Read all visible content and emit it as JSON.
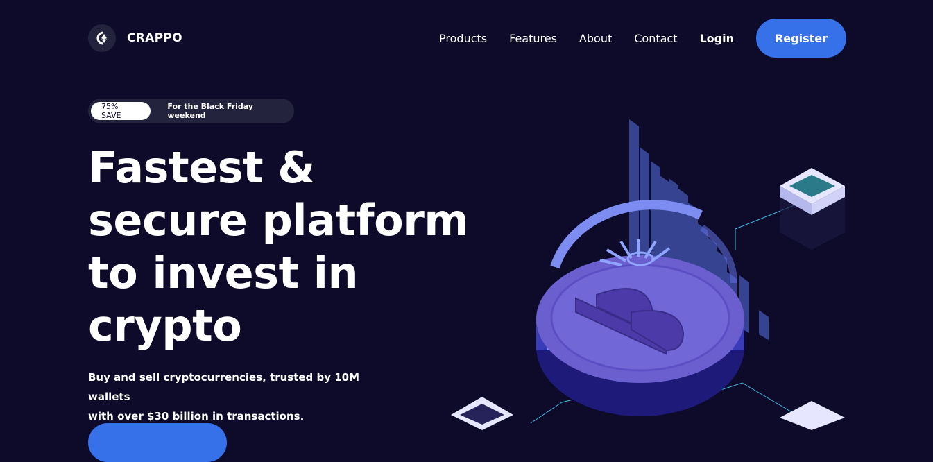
{
  "brand": {
    "name": "CRAPPO",
    "logo_icon": "ethereum-coin-icon"
  },
  "nav": {
    "links": [
      "Products",
      "Features",
      "About",
      "Contact"
    ],
    "login_label": "Login",
    "register_label": "Register"
  },
  "promo": {
    "badge": "75% SAVE",
    "text": "For the Black Friday weekend"
  },
  "hero": {
    "title_lines": [
      "Fastest &",
      "secure platform",
      "to invest in",
      "crypto"
    ],
    "subtitle_lines": [
      "Buy and sell cryptocurrencies, trusted by 10M wallets",
      "with over $30 billion in transactions."
    ]
  },
  "illustration": {
    "icon": "bitcoin-coin-icon"
  },
  "colors": {
    "background": "#0d0b29",
    "accent": "#3671e9",
    "pill": "#24233d",
    "coin": "#6b5fd0"
  }
}
